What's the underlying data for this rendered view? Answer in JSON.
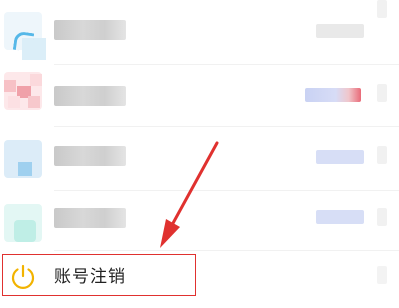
{
  "settings_list": {
    "items": [
      {
        "id": "row1",
        "label": "",
        "blurred": true
      },
      {
        "id": "row2",
        "label": "",
        "blurred": true
      },
      {
        "id": "row3",
        "label": "",
        "blurred": true
      },
      {
        "id": "row4",
        "label": "",
        "blurred": true
      },
      {
        "id": "account-deletion",
        "label": "账号注销",
        "icon": "power-icon"
      }
    ]
  },
  "colors": {
    "power_icon": "#f2b300",
    "annotation": "#e0312f",
    "text": "#222222"
  },
  "annotation": {
    "type": "red-arrow-and-box",
    "target": "account-deletion"
  }
}
